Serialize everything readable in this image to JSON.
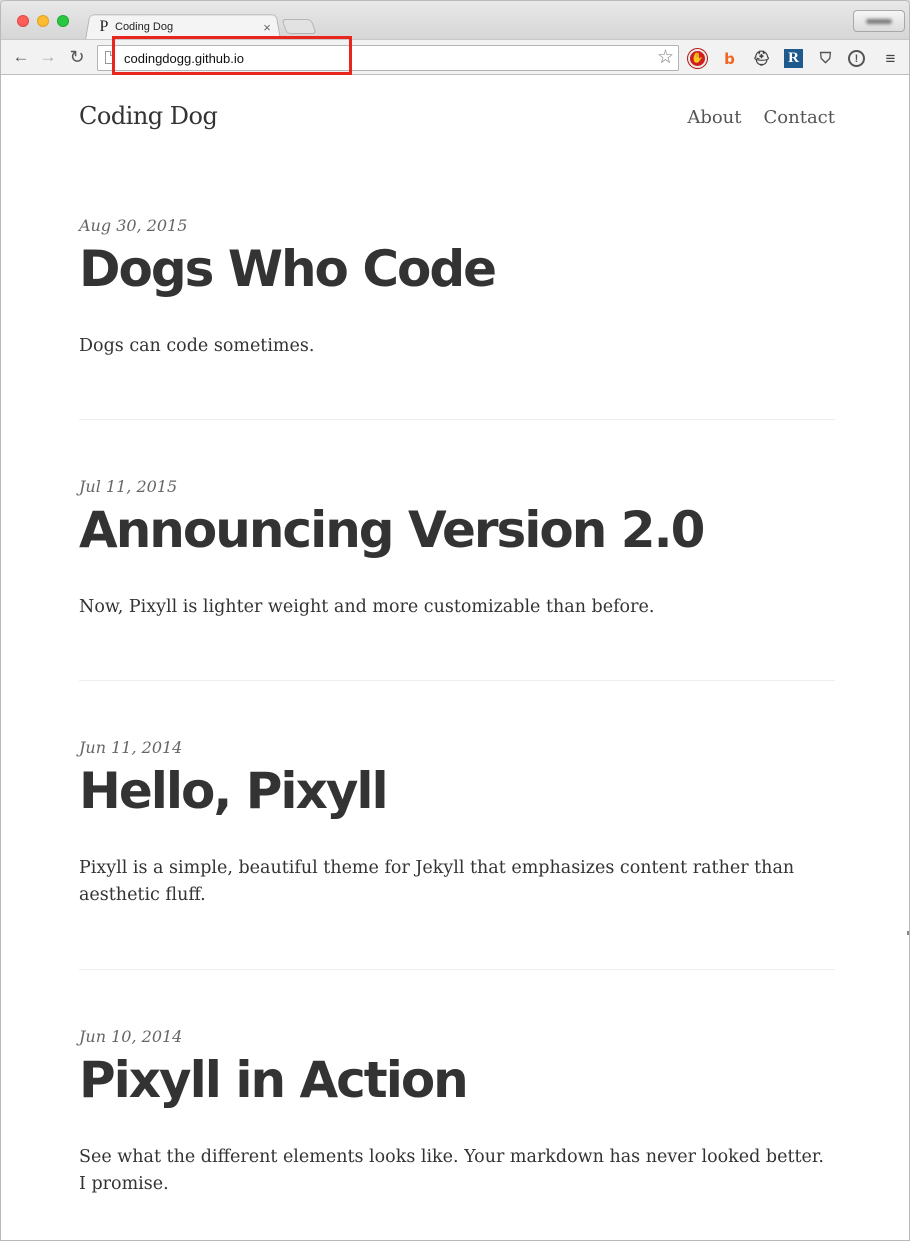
{
  "browser": {
    "tab": {
      "favicon": "P",
      "title": "Coding Dog",
      "close_glyph": "×"
    },
    "toolbar": {
      "back_glyph": "←",
      "forward_glyph": "→",
      "reload_glyph": "↻",
      "url": "codingdogg.github.io",
      "star_glyph": "☆",
      "extensions": {
        "adblock_glyph": "✋",
        "b_glyph": "b",
        "hat_glyph": "⛑",
        "r_glyph": "R",
        "pocket_glyph": "⛉",
        "info_glyph": "!",
        "menu_glyph": "≡"
      }
    },
    "highlight_color": "#e8261e"
  },
  "site": {
    "title": "Coding Dog",
    "nav": [
      {
        "label": "About"
      },
      {
        "label": "Contact"
      }
    ]
  },
  "posts": [
    {
      "date": "Aug 30, 2015",
      "title": "Dogs Who Code",
      "summary": "Dogs can code sometimes."
    },
    {
      "date": "Jul 11, 2015",
      "title": "Announcing Version 2.0",
      "summary": "Now, Pixyll is lighter weight and more customizable than before."
    },
    {
      "date": "Jun 11, 2014",
      "title": "Hello, Pixyll",
      "summary": "Pixyll is a simple, beautiful theme for Jekyll that emphasizes content rather than aesthetic fluff."
    },
    {
      "date": "Jun 10, 2014",
      "title": "Pixyll in Action",
      "summary": "See what the different elements looks like. Your markdown has never looked better. I promise."
    }
  ]
}
